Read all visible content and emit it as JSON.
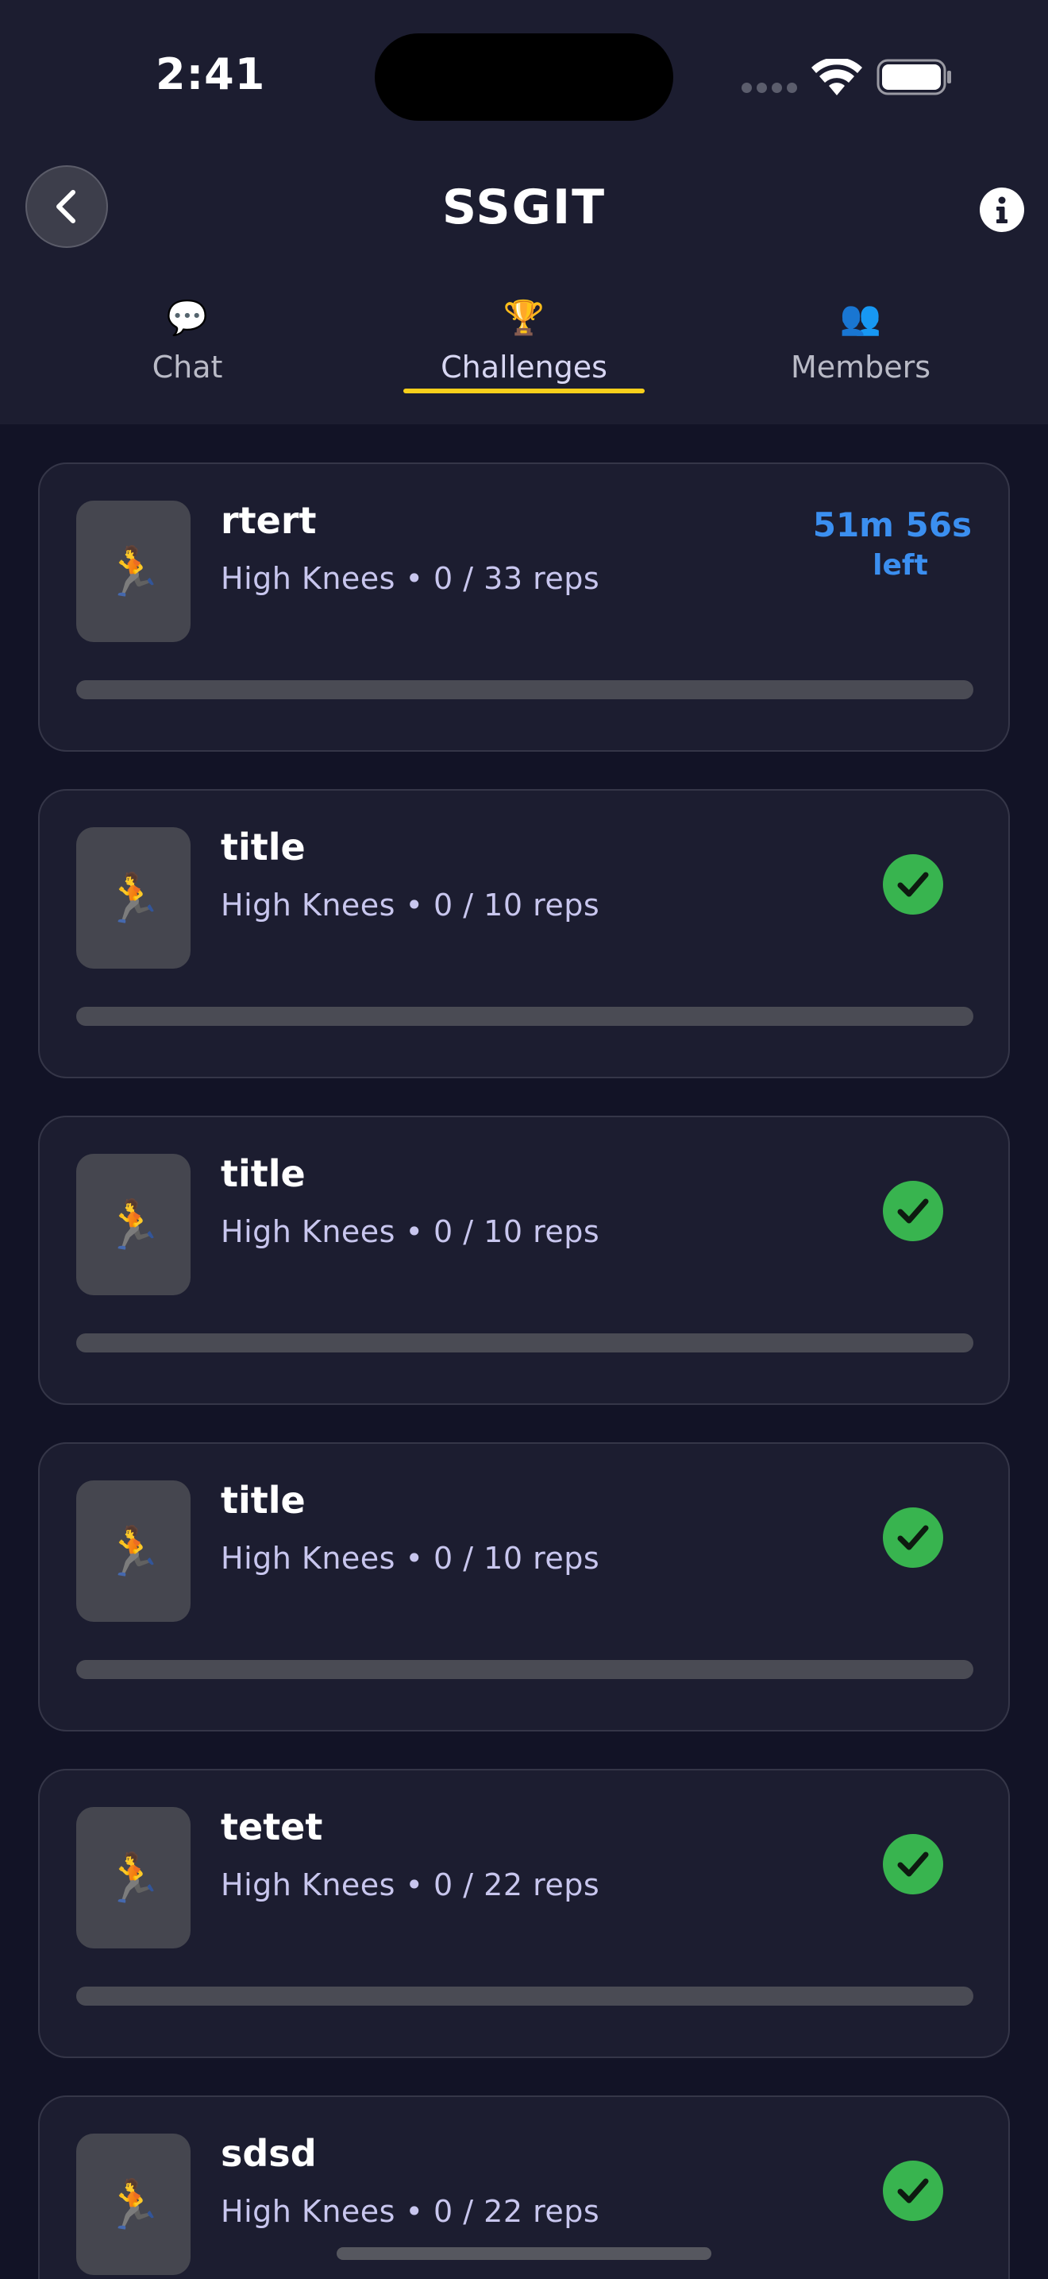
{
  "status_bar": {
    "time": "2:41"
  },
  "header": {
    "title": "SSGIT"
  },
  "tabs": [
    {
      "label": "Chat",
      "icon": "💬",
      "icon_name": "speech-bubble-icon",
      "active": false
    },
    {
      "label": "Challenges",
      "icon": "🏆",
      "icon_name": "trophy-icon",
      "active": true
    },
    {
      "label": "Members",
      "icon": "👥",
      "icon_name": "people-icon",
      "active": false
    }
  ],
  "accent": {
    "tab_underline": "#f7cf1b",
    "timer": "#3b8ff0",
    "check": "#38b44f"
  },
  "challenges": [
    {
      "title": "rtert",
      "subtitle": "High Knees • 0 / 33 reps",
      "icon": "🏃",
      "icon_name": "runner-icon",
      "progress": 0,
      "timer_value": "51m 56s",
      "timer_label": "left",
      "completed": false
    },
    {
      "title": "title",
      "subtitle": "High Knees • 0 / 10 reps",
      "icon": "🏃",
      "icon_name": "runner-icon",
      "progress": 0,
      "completed": true
    },
    {
      "title": "title",
      "subtitle": "High Knees • 0 / 10 reps",
      "icon": "🏃",
      "icon_name": "runner-icon",
      "progress": 0,
      "completed": true
    },
    {
      "title": "title",
      "subtitle": "High Knees • 0 / 10 reps",
      "icon": "🏃",
      "icon_name": "runner-icon",
      "progress": 0,
      "completed": true
    },
    {
      "title": "tetet",
      "subtitle": "High Knees • 0 / 22 reps",
      "icon": "🏃",
      "icon_name": "runner-icon",
      "progress": 0,
      "completed": true
    },
    {
      "title": "sdsd",
      "subtitle": "High Knees • 0 / 22 reps",
      "icon": "🏃",
      "icon_name": "runner-icon",
      "progress": 0,
      "completed": true
    }
  ]
}
